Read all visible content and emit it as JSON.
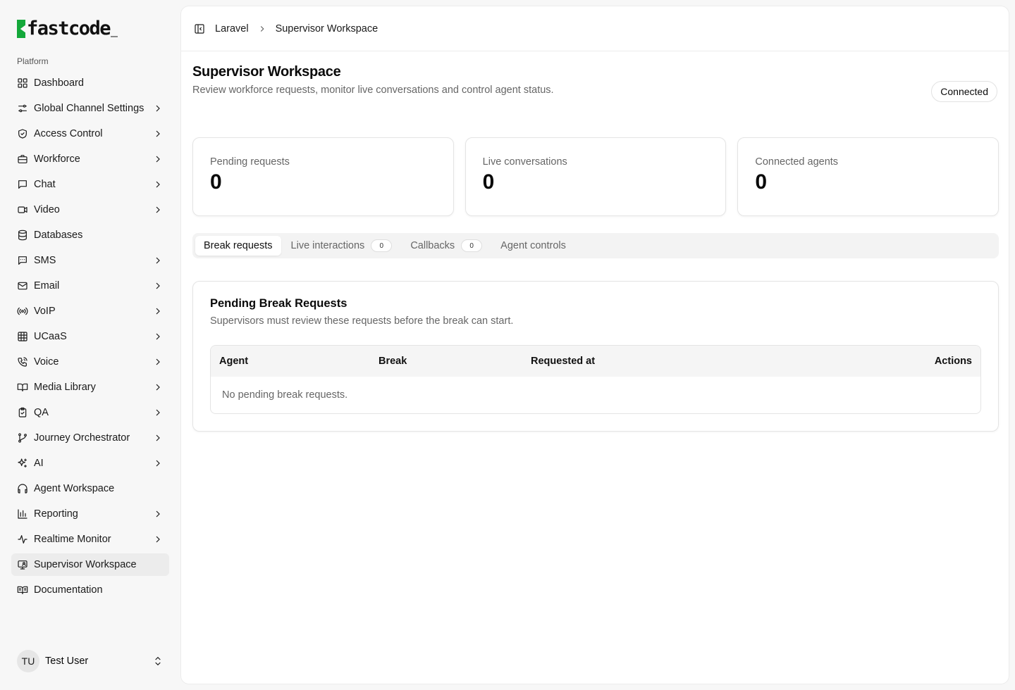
{
  "brand": {
    "name": "fastcode",
    "accent": "#14a83a"
  },
  "sidebar": {
    "group_label": "Platform",
    "items": [
      {
        "label": "Dashboard",
        "icon": "dashboard-icon",
        "chevron": false
      },
      {
        "label": "Global Channel Settings",
        "icon": "sliders-icon",
        "chevron": true
      },
      {
        "label": "Access Control",
        "icon": "shield-icon",
        "chevron": true
      },
      {
        "label": "Workforce",
        "icon": "briefcase-icon",
        "chevron": true
      },
      {
        "label": "Chat",
        "icon": "chat-icon",
        "chevron": true
      },
      {
        "label": "Video",
        "icon": "video-icon",
        "chevron": true
      },
      {
        "label": "Databases",
        "icon": "database-icon",
        "chevron": false
      },
      {
        "label": "SMS",
        "icon": "sms-icon",
        "chevron": true
      },
      {
        "label": "Email",
        "icon": "mail-icon",
        "chevron": true
      },
      {
        "label": "VoIP",
        "icon": "radio-icon",
        "chevron": true
      },
      {
        "label": "UCaaS",
        "icon": "grid-icon",
        "chevron": true
      },
      {
        "label": "Voice",
        "icon": "phone-icon",
        "chevron": true
      },
      {
        "label": "Media Library",
        "icon": "book-open-icon",
        "chevron": true
      },
      {
        "label": "QA",
        "icon": "clipboard-check-icon",
        "chevron": true
      },
      {
        "label": "Journey Orchestrator",
        "icon": "git-branch-icon",
        "chevron": true
      },
      {
        "label": "AI",
        "icon": "sparkles-icon",
        "chevron": true
      },
      {
        "label": "Agent Workspace",
        "icon": "headphones-icon",
        "chevron": false
      },
      {
        "label": "Reporting",
        "icon": "bar-chart-icon",
        "chevron": true
      },
      {
        "label": "Realtime Monitor",
        "icon": "activity-icon",
        "chevron": true
      },
      {
        "label": "Supervisor Workspace",
        "icon": "monitor-user-icon",
        "chevron": false,
        "active": true
      },
      {
        "label": "Documentation",
        "icon": "book-icon",
        "chevron": false
      }
    ],
    "user": {
      "initials": "TU",
      "name": "Test User"
    }
  },
  "header": {
    "breadcrumb": [
      "Laravel",
      "Supervisor Workspace"
    ]
  },
  "page": {
    "title": "Supervisor Workspace",
    "subtitle": "Review workforce requests, monitor live conversations and control agent status.",
    "status": "Connected"
  },
  "stats": [
    {
      "label": "Pending requests",
      "value": "0"
    },
    {
      "label": "Live conversations",
      "value": "0"
    },
    {
      "label": "Connected agents",
      "value": "0"
    }
  ],
  "tabs": [
    {
      "label": "Break requests",
      "active": true
    },
    {
      "label": "Live interactions",
      "count": "0"
    },
    {
      "label": "Callbacks",
      "count": "0"
    },
    {
      "label": "Agent controls"
    }
  ],
  "panel": {
    "title": "Pending Break Requests",
    "subtitle": "Supervisors must review these requests before the break can start.",
    "columns": [
      "Agent",
      "Break",
      "Requested at",
      "Actions"
    ],
    "empty": "No pending break requests."
  }
}
